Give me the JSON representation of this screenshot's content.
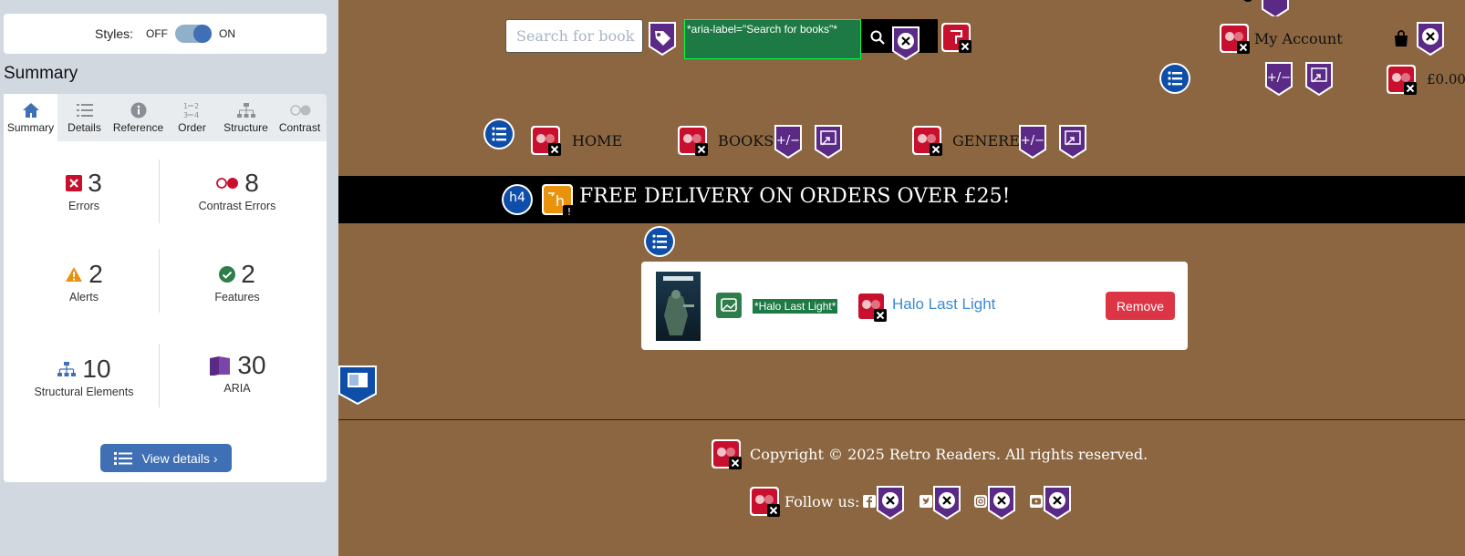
{
  "panel": {
    "styles_label": "Styles:",
    "toggle_off": "OFF",
    "toggle_on": "ON",
    "summary_title": "Summary",
    "tabs": [
      {
        "label": "Summary",
        "icon": "home-icon"
      },
      {
        "label": "Details",
        "icon": "list-icon"
      },
      {
        "label": "Reference",
        "icon": "info-icon"
      },
      {
        "label": "Order",
        "icon": "order-icon"
      },
      {
        "label": "Structure",
        "icon": "structure-icon"
      },
      {
        "label": "Contrast",
        "icon": "contrast-icon"
      }
    ],
    "stats": {
      "errors": {
        "value": "3",
        "label": "Errors"
      },
      "contrast": {
        "value": "8",
        "label": "Contrast Errors"
      },
      "alerts": {
        "value": "2",
        "label": "Alerts"
      },
      "features": {
        "value": "2",
        "label": "Features"
      },
      "structural": {
        "value": "10",
        "label": "Structural Elements"
      },
      "aria": {
        "value": "30",
        "label": "ARIA"
      }
    },
    "view_details": "View details ›"
  },
  "site": {
    "search_placeholder": "Search for book",
    "aria_label_tag": "*aria-label=\"Search for books\"*",
    "my_account": "My Account",
    "cart_total": "£0.00",
    "nav": {
      "home": "HOME",
      "books": "BOOKS",
      "genere": "GENERE"
    },
    "h4_badge": "h4",
    "delivery_banner": "FREE DELIVERY ON ORDERS OVER £25!",
    "cart_item": {
      "alt_tag": "*Halo Last Light*",
      "title": "Halo Last Light",
      "remove": "Remove"
    },
    "copyright": "Copyright © 2025 Retro Readers. All rights reserved.",
    "follow_us": "Follow us:"
  },
  "colors": {
    "site_bg": "#8b6640",
    "panel_bg": "#d2d8e0",
    "accent_blue": "#3f6fb5",
    "error_red": "#c8102e",
    "aria_purple": "#5b2a86",
    "label_green": "#1e7a45"
  }
}
